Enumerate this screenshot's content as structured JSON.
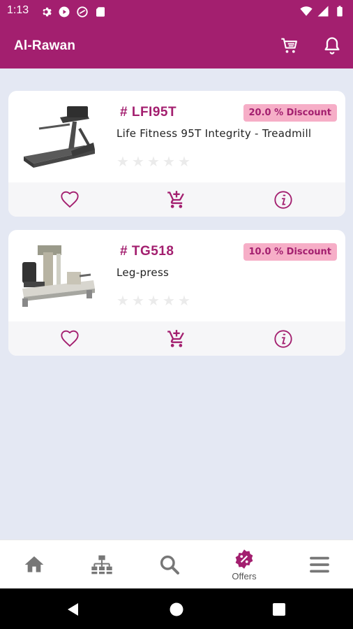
{
  "status_bar": {
    "time": "1:13"
  },
  "app_bar": {
    "title": "Al-Rawan"
  },
  "products": [
    {
      "sku": "# LFI95T",
      "discount": "20.0 % Discount",
      "name": "Life Fitness 95T Integrity - Treadmill",
      "rating": 0,
      "max_rating": 5
    },
    {
      "sku": "# TG518",
      "discount": "10.0 % Discount",
      "name": "Leg-press",
      "rating": 0,
      "max_rating": 5
    }
  ],
  "bottom_nav": {
    "items": [
      {
        "id": "home",
        "icon": "home-icon",
        "label": ""
      },
      {
        "id": "categories",
        "icon": "sitemap-icon",
        "label": ""
      },
      {
        "id": "search",
        "icon": "search-icon",
        "label": ""
      },
      {
        "id": "offers",
        "icon": "offers-badge-icon",
        "label": "Offers",
        "active": true
      },
      {
        "id": "menu",
        "icon": "hamburger-menu-icon",
        "label": ""
      }
    ]
  },
  "colors": {
    "primary": "#a31f6f",
    "background": "#e4e8f3",
    "discount_bg": "#f6aec7",
    "inactive_icon": "#777777"
  }
}
